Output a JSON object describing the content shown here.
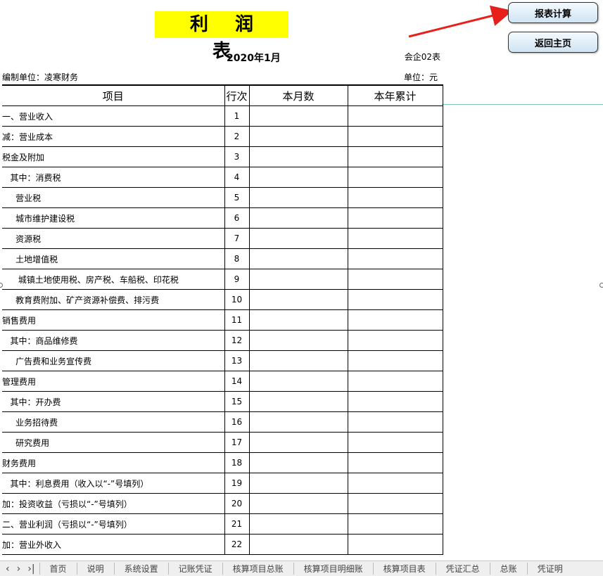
{
  "report": {
    "title": "利润表",
    "date": "2020年1月",
    "form_code": "会企02表",
    "compiler_label": "编制单位：凌寒财务",
    "unit_label": "单位：元"
  },
  "buttons": {
    "calculate": "报表计算",
    "home": "返回主页"
  },
  "columns": [
    "项目",
    "行次",
    "本月数",
    "本年累计"
  ],
  "rows": [
    {
      "item": "一、营业收入",
      "line": "1"
    },
    {
      "item": "减：营业成本",
      "line": "2"
    },
    {
      "item": "税金及附加",
      "line": "3"
    },
    {
      "item": "   其中：消费税",
      "line": "4"
    },
    {
      "item": "     营业税",
      "line": "5"
    },
    {
      "item": "     城市维护建设税",
      "line": "6"
    },
    {
      "item": "     资源税",
      "line": "7"
    },
    {
      "item": "     土地增值税",
      "line": "8"
    },
    {
      "item": "      城镇土地使用税、房产税、车船税、印花税",
      "line": "9"
    },
    {
      "item": "     教育费附加、矿产资源补偿费、排污费",
      "line": "10"
    },
    {
      "item": "销售费用",
      "line": "11"
    },
    {
      "item": "   其中：商品维修费",
      "line": "12"
    },
    {
      "item": "     广告费和业务宣传费",
      "line": "13"
    },
    {
      "item": "管理费用",
      "line": "14"
    },
    {
      "item": "   其中：开办费",
      "line": "15"
    },
    {
      "item": "     业务招待费",
      "line": "16"
    },
    {
      "item": "     研究费用",
      "line": "17"
    },
    {
      "item": "财务费用",
      "line": "18"
    },
    {
      "item": "   其中：利息费用（收入以“-”号填列）",
      "line": "19"
    },
    {
      "item": "加：投资收益（亏损以“-”号填列）",
      "line": "20"
    },
    {
      "item": "二、营业利润（亏损以“-”号填列）",
      "line": "21"
    },
    {
      "item": "加：营业外收入",
      "line": "22"
    }
  ],
  "sheet_tabs": [
    "首页",
    "说明",
    "系统设置",
    "记账凭证",
    "核算项目总账",
    "核算项目明细账",
    "核算项目表",
    "凭证汇总",
    "总账",
    "凭证明"
  ],
  "colors": {
    "title_bg": "#ffff00",
    "arrow": "#e8201c",
    "button_bg": "#d6e8f5"
  }
}
